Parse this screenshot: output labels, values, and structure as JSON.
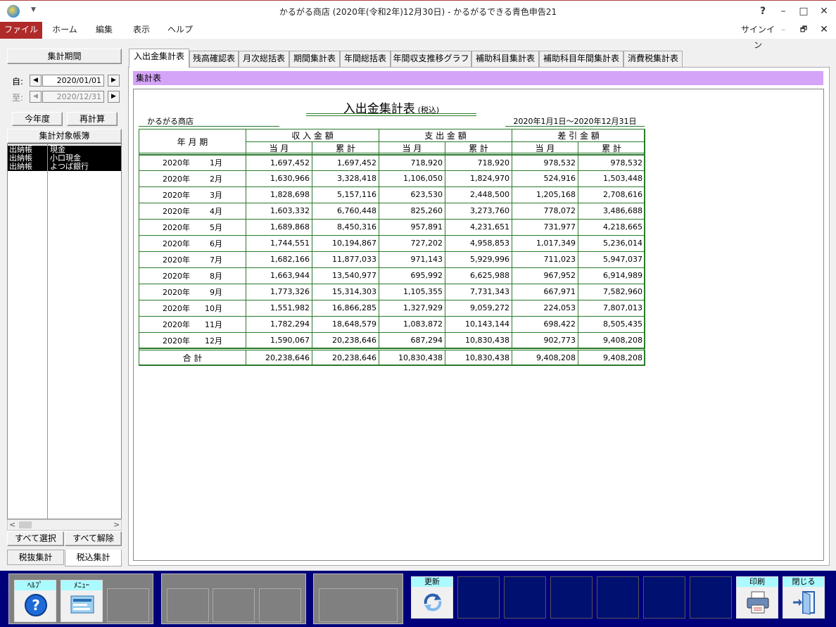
{
  "window": {
    "title": "かるがる商店 (2020年(令和2年)12月30日) - かるがるできる青色申告21",
    "help": "?",
    "minimize": "–",
    "maximize": "□",
    "close": "✕",
    "signin": "サインイン",
    "restore": "🗗"
  },
  "menu": {
    "file": "ファイル",
    "home": "ホーム",
    "edit": "編集",
    "view": "表示",
    "help": "ヘルプ"
  },
  "left": {
    "period_header": "集計期間",
    "from_label": "自:",
    "to_label": "至:",
    "from_date": "2020/01/01",
    "to_date": "2020/12/31",
    "this_year": "今年度",
    "recalc": "再計算",
    "ledgers_header": "集計対象帳簿",
    "ledgers": [
      {
        "type": "出納帳",
        "name": "現金"
      },
      {
        "type": "出納帳",
        "name": "小口現金"
      },
      {
        "type": "出納帳",
        "name": "よつば銀行"
      }
    ],
    "select_all": "すべて選択",
    "deselect_all": "すべて解除",
    "tax_excl": "税抜集計",
    "tax_incl": "税込集計"
  },
  "tabs": [
    "入出金集計表",
    "残高確認表",
    "月次総括表",
    "期間集計表",
    "年間総括表",
    "年間収支推移グラフ",
    "補助科目集計表",
    "補助科目年間集計表",
    "消費税集計表"
  ],
  "section_label": "集計表",
  "report": {
    "title": "入出金集計表",
    "title_note": "(税込)",
    "company": "かるがる商店",
    "period": "2020年1月1日～2020年12月31日",
    "col_period": "年 月 期",
    "col_income": "収 入 金 額",
    "col_expense": "支 出 金 額",
    "col_diff": "差 引 金 額",
    "sub_month": "当 月",
    "sub_cum": "累 計",
    "rows": [
      {
        "year": "2020年",
        "month": "1月",
        "v": [
          "1,697,452",
          "1,697,452",
          "718,920",
          "718,920",
          "978,532",
          "978,532"
        ]
      },
      {
        "year": "2020年",
        "month": "2月",
        "v": [
          "1,630,966",
          "3,328,418",
          "1,106,050",
          "1,824,970",
          "524,916",
          "1,503,448"
        ]
      },
      {
        "year": "2020年",
        "month": "3月",
        "v": [
          "1,828,698",
          "5,157,116",
          "623,530",
          "2,448,500",
          "1,205,168",
          "2,708,616"
        ]
      },
      {
        "year": "2020年",
        "month": "4月",
        "v": [
          "1,603,332",
          "6,760,448",
          "825,260",
          "3,273,760",
          "778,072",
          "3,486,688"
        ]
      },
      {
        "year": "2020年",
        "month": "5月",
        "v": [
          "1,689,868",
          "8,450,316",
          "957,891",
          "4,231,651",
          "731,977",
          "4,218,665"
        ]
      },
      {
        "year": "2020年",
        "month": "6月",
        "v": [
          "1,744,551",
          "10,194,867",
          "727,202",
          "4,958,853",
          "1,017,349",
          "5,236,014"
        ]
      },
      {
        "year": "2020年",
        "month": "7月",
        "v": [
          "1,682,166",
          "11,877,033",
          "971,143",
          "5,929,996",
          "711,023",
          "5,947,037"
        ]
      },
      {
        "year": "2020年",
        "month": "8月",
        "v": [
          "1,663,944",
          "13,540,977",
          "695,992",
          "6,625,988",
          "967,952",
          "6,914,989"
        ]
      },
      {
        "year": "2020年",
        "month": "9月",
        "v": [
          "1,773,326",
          "15,314,303",
          "1,105,355",
          "7,731,343",
          "667,971",
          "7,582,960"
        ]
      },
      {
        "year": "2020年",
        "month": "10月",
        "v": [
          "1,551,982",
          "16,866,285",
          "1,327,929",
          "9,059,272",
          "224,053",
          "7,807,013"
        ]
      },
      {
        "year": "2020年",
        "month": "11月",
        "v": [
          "1,782,294",
          "18,648,579",
          "1,083,872",
          "10,143,144",
          "698,422",
          "8,505,435"
        ]
      },
      {
        "year": "2020年",
        "month": "12月",
        "v": [
          "1,590,067",
          "20,238,646",
          "687,294",
          "10,830,438",
          "902,773",
          "9,408,208"
        ]
      }
    ],
    "total_label": "合 計",
    "total": [
      "20,238,646",
      "20,238,646",
      "10,830,438",
      "10,830,438",
      "9,408,208",
      "9,408,208"
    ]
  },
  "toolbar": {
    "help": "ﾍﾙﾌﾟ",
    "menu": "ﾒﾆｭｰ",
    "refresh": "更新",
    "print": "印刷",
    "close": "閉じる"
  }
}
